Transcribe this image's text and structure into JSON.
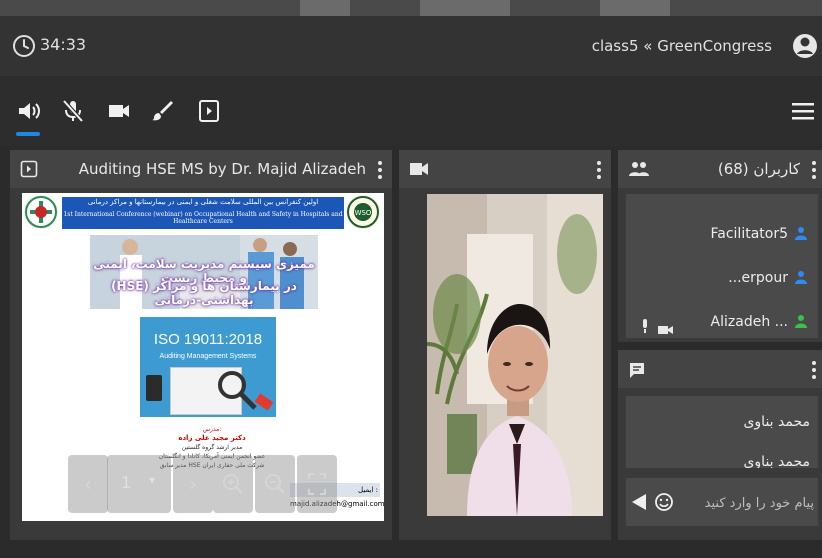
{
  "header": {
    "timer": "34:33",
    "room_name": "class5 « GreenCongress"
  },
  "toolbar": {
    "buttons": [
      "speaker-icon",
      "mic-muted-icon",
      "camera-icon",
      "brush-icon",
      "presentation-icon",
      "menu-icon"
    ],
    "active": "speaker-icon",
    "accent_color": "#1e88e5"
  },
  "presentation": {
    "title": "Auditing HSE MS by Dr. Majid Alizadeh",
    "slide": {
      "header_fa": "اولین کنفرانس بین المللی سلامت شغلی و ایمنی در بیمارستانها و مراکز درمانی",
      "header_en": "1st International Conference (webinar) on Occupational Health and Safety in Hospitals and Healthcare Centers",
      "banner_line1": "ممیزی سیستم مدیریت سلامت، ایمنی و محیط زیست",
      "banner_line2": "(HSE) در بیمارستان ها و مراکز بهداشتی-درمانی",
      "iso_title": "ISO 19011:2018",
      "iso_subtitle": "Auditing Management Systems",
      "lecturer_label": "مدرس:",
      "lecturer_name": "دکتر مجید علی زاده",
      "lecturer_d1": "مدیر ارشد گروه گلستین",
      "lecturer_d2": "عضو انجمن ایمنی آمریکا، کانادا و انگلستان",
      "lecturer_d3": "مدیر سابق HSE شرکت ملی حفاری ایران",
      "email_label": "ایمیل : majid.alizadeh@gmail.com"
    },
    "page": "1"
  },
  "video": {
    "has_feed": true
  },
  "users": {
    "title": "کاربران (68)",
    "items": [
      {
        "name": "Facilitator5",
        "color": "#2d8cf0"
      },
      {
        "name": "...erpour",
        "color": "#2d8cf0"
      },
      {
        "name": "Alizadeh ...",
        "color": "#39c24a"
      }
    ]
  },
  "chat": {
    "messages": [
      "محمد بناوی",
      "محمد بناوی"
    ],
    "placeholder": "پیام خود را وارد کنید"
  }
}
